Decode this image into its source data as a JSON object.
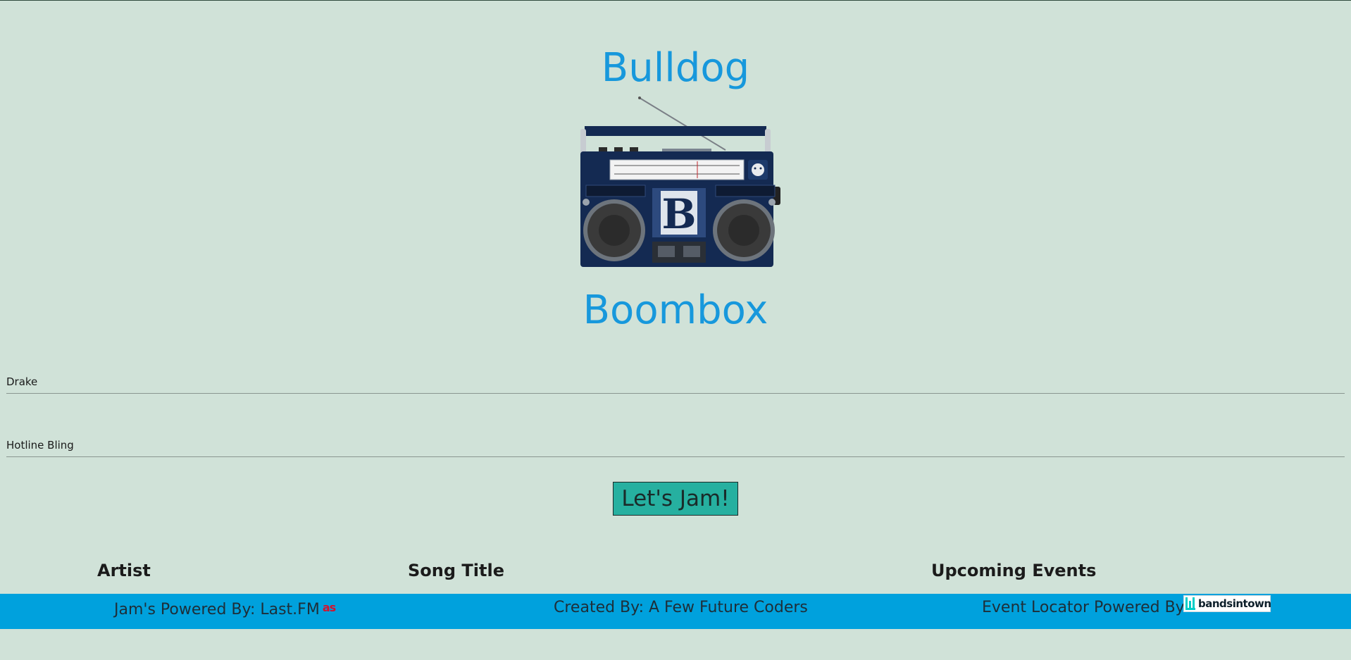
{
  "header": {
    "title_top": "Bulldog",
    "title_bottom": "Boombox"
  },
  "logo": {
    "icon": "boombox-icon",
    "badge_letter": "B",
    "colors": {
      "body": "#142a52",
      "trim": "#1d3a6b",
      "speaker": "#3a3a3a"
    }
  },
  "search": {
    "artist_value": "Drake",
    "song_value": "Hotline Bling",
    "submit_label": "Let's Jam!"
  },
  "results": {
    "columns": [
      "Artist",
      "Song Title",
      "Upcoming Events"
    ]
  },
  "footer": {
    "left_text": "Jam's Powered By: Last.FM",
    "lastfm_icon_text": "as",
    "center_text": "Created By: A Few Future Coders",
    "right_text": "Event Locator Powered By:",
    "bandsintown_text": "bandsintown"
  },
  "colors": {
    "background": "#d0e2d8",
    "title": "#1798dc",
    "button": "#26b0a0",
    "footer": "#00a1dd",
    "lastfm": "#d6102c"
  }
}
